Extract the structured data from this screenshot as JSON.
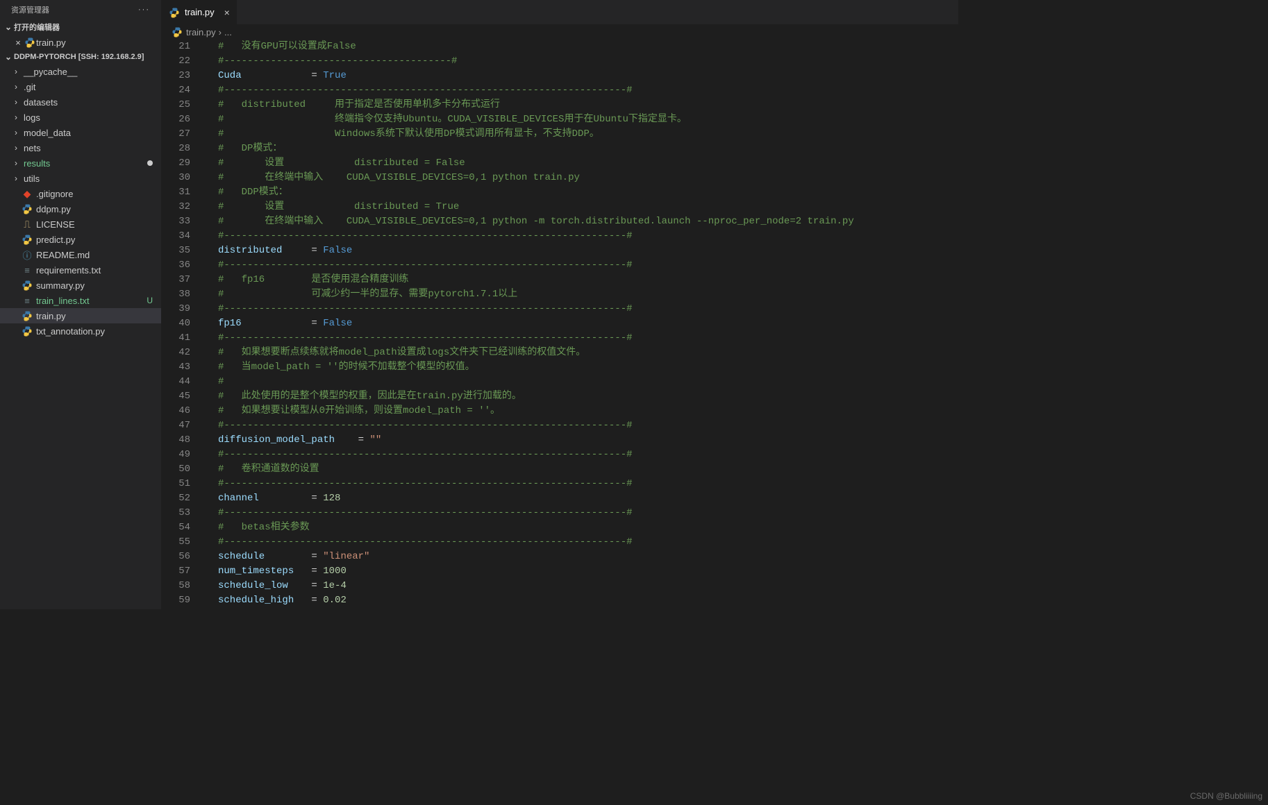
{
  "sidebar": {
    "title": "资源管理器",
    "more_glyph": "···",
    "open_editors_label": "打开的编辑器",
    "open_editors": [
      {
        "name": "train.py",
        "icon": "python"
      }
    ],
    "workspace_label": "DDPM-PYTORCH [SSH: 192.168.2.9]",
    "tree": [
      {
        "type": "folder",
        "name": "__pycache__"
      },
      {
        "type": "folder",
        "name": ".git"
      },
      {
        "type": "folder",
        "name": "datasets"
      },
      {
        "type": "folder",
        "name": "logs"
      },
      {
        "type": "folder",
        "name": "model_data"
      },
      {
        "type": "folder",
        "name": "nets"
      },
      {
        "type": "folder",
        "name": "results",
        "modified": true,
        "emerald": true
      },
      {
        "type": "folder",
        "name": "utils"
      },
      {
        "type": "file",
        "name": ".gitignore",
        "icon": "git"
      },
      {
        "type": "file",
        "name": "ddpm.py",
        "icon": "python"
      },
      {
        "type": "file",
        "name": "LICENSE",
        "icon": "license"
      },
      {
        "type": "file",
        "name": "predict.py",
        "icon": "python"
      },
      {
        "type": "file",
        "name": "README.md",
        "icon": "info"
      },
      {
        "type": "file",
        "name": "requirements.txt",
        "icon": "txt"
      },
      {
        "type": "file",
        "name": "summary.py",
        "icon": "python"
      },
      {
        "type": "file",
        "name": "train_lines.txt",
        "icon": "txt",
        "emerald": true,
        "badge": "U"
      },
      {
        "type": "file",
        "name": "train.py",
        "icon": "python",
        "active": true
      },
      {
        "type": "file",
        "name": "txt_annotation.py",
        "icon": "python"
      }
    ]
  },
  "tab": {
    "name": "train.py",
    "close_glyph": "×"
  },
  "breadcrumb": {
    "file": "train.py",
    "sep": "›",
    "tail": "..."
  },
  "editor": {
    "first_line": 21,
    "lines": [
      [
        [
          "comment",
          "#   没有GPU可以设置成False"
        ]
      ],
      [
        [
          "comment",
          "#---------------------------------------#"
        ]
      ],
      [
        [
          "var",
          "Cuda"
        ],
        [
          "op",
          "            = "
        ],
        [
          "const",
          "True"
        ]
      ],
      [
        [
          "comment",
          "#---------------------------------------------------------------------#"
        ]
      ],
      [
        [
          "comment",
          "#   distributed     用于指定是否使用单机多卡分布式运行"
        ]
      ],
      [
        [
          "comment",
          "#                   终端指令仅支持Ubuntu。CUDA_VISIBLE_DEVICES用于在Ubuntu下指定显卡。"
        ]
      ],
      [
        [
          "comment",
          "#                   Windows系统下默认使用DP模式调用所有显卡，不支持DDP。"
        ]
      ],
      [
        [
          "comment",
          "#   DP模式："
        ]
      ],
      [
        [
          "comment",
          "#       设置            distributed = False"
        ]
      ],
      [
        [
          "comment",
          "#       在终端中输入    CUDA_VISIBLE_DEVICES=0,1 python train.py"
        ]
      ],
      [
        [
          "comment",
          "#   DDP模式："
        ]
      ],
      [
        [
          "comment",
          "#       设置            distributed = True"
        ]
      ],
      [
        [
          "comment",
          "#       在终端中输入    CUDA_VISIBLE_DEVICES=0,1 python -m torch.distributed.launch --nproc_per_node=2 train.py"
        ]
      ],
      [
        [
          "comment",
          "#---------------------------------------------------------------------#"
        ]
      ],
      [
        [
          "var",
          "distributed"
        ],
        [
          "op",
          "     = "
        ],
        [
          "const",
          "False"
        ]
      ],
      [
        [
          "comment",
          "#---------------------------------------------------------------------#"
        ]
      ],
      [
        [
          "comment",
          "#   fp16        是否使用混合精度训练"
        ]
      ],
      [
        [
          "comment",
          "#               可减少约一半的显存、需要pytorch1.7.1以上"
        ]
      ],
      [
        [
          "comment",
          "#---------------------------------------------------------------------#"
        ]
      ],
      [
        [
          "var",
          "fp16"
        ],
        [
          "op",
          "            = "
        ],
        [
          "const",
          "False"
        ]
      ],
      [
        [
          "comment",
          "#---------------------------------------------------------------------#"
        ]
      ],
      [
        [
          "comment",
          "#   如果想要断点续练就将model_path设置成logs文件夹下已经训练的权值文件。 "
        ]
      ],
      [
        [
          "comment",
          "#   当model_path = ''的时候不加载整个模型的权值。"
        ]
      ],
      [
        [
          "comment",
          "#"
        ]
      ],
      [
        [
          "comment",
          "#   此处使用的是整个模型的权重，因此是在train.py进行加载的。"
        ]
      ],
      [
        [
          "comment",
          "#   如果想要让模型从0开始训练，则设置model_path = ''。"
        ]
      ],
      [
        [
          "comment",
          "#---------------------------------------------------------------------#"
        ]
      ],
      [
        [
          "var",
          "diffusion_model_path"
        ],
        [
          "op",
          "    = "
        ],
        [
          "str",
          "\"\""
        ]
      ],
      [
        [
          "comment",
          "#---------------------------------------------------------------------#"
        ]
      ],
      [
        [
          "comment",
          "#   卷积通道数的设置"
        ]
      ],
      [
        [
          "comment",
          "#---------------------------------------------------------------------#"
        ]
      ],
      [
        [
          "var",
          "channel"
        ],
        [
          "op",
          "         = "
        ],
        [
          "num",
          "128"
        ]
      ],
      [
        [
          "comment",
          "#---------------------------------------------------------------------#"
        ]
      ],
      [
        [
          "comment",
          "#   betas相关参数"
        ]
      ],
      [
        [
          "comment",
          "#---------------------------------------------------------------------#"
        ]
      ],
      [
        [
          "var",
          "schedule"
        ],
        [
          "op",
          "        = "
        ],
        [
          "str",
          "\"linear\""
        ]
      ],
      [
        [
          "var",
          "num_timesteps"
        ],
        [
          "op",
          "   = "
        ],
        [
          "num",
          "1000"
        ]
      ],
      [
        [
          "var",
          "schedule_low"
        ],
        [
          "op",
          "    = "
        ],
        [
          "num",
          "1e-4"
        ]
      ],
      [
        [
          "var",
          "schedule_high"
        ],
        [
          "op",
          "   = "
        ],
        [
          "num",
          "0.02"
        ]
      ]
    ]
  },
  "watermark": "CSDN @Bubbliiiing"
}
